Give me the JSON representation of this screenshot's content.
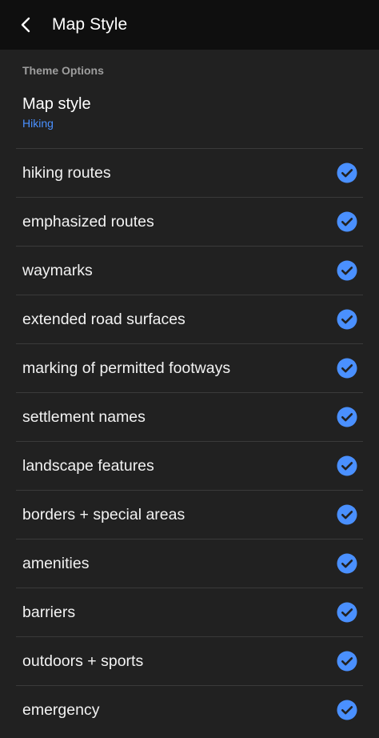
{
  "header": {
    "title": "Map Style",
    "back_icon": "chevron-left-icon"
  },
  "section": {
    "title": "Theme Options"
  },
  "map_style": {
    "label": "Map style",
    "value": "Hiking"
  },
  "colors": {
    "accent": "#4a90ff",
    "background": "#212121",
    "topbar": "#0f0f0f",
    "divider": "#3a3a3a",
    "section_text": "#9e9e9e"
  },
  "items": [
    {
      "label": "hiking routes",
      "checked": true
    },
    {
      "label": "emphasized routes",
      "checked": true
    },
    {
      "label": "waymarks",
      "checked": true
    },
    {
      "label": "extended road surfaces",
      "checked": true
    },
    {
      "label": "marking of permitted footways",
      "checked": true
    },
    {
      "label": "settlement names",
      "checked": true
    },
    {
      "label": "landscape features",
      "checked": true
    },
    {
      "label": "borders + special areas",
      "checked": true
    },
    {
      "label": "amenities",
      "checked": true
    },
    {
      "label": "barriers",
      "checked": true
    },
    {
      "label": "outdoors + sports",
      "checked": true
    },
    {
      "label": "emergency",
      "checked": true
    }
  ]
}
